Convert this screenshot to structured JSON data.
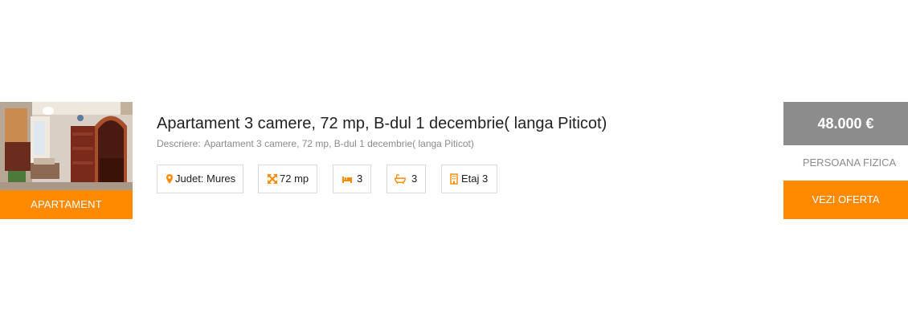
{
  "listing": {
    "type_label": "APARTAMENT",
    "title": "Apartament 3 camere, 72 mp, B-dul 1 decembrie( langa Piticot)",
    "description_label": "Descriere:",
    "description_text": "Apartament 3 camere, 72 mp, B-dul 1 decembrie( langa Piticot)",
    "features": {
      "county": {
        "icon": "map-marker-icon",
        "text": "Judet: Mures"
      },
      "area": {
        "icon": "expand-arrows-icon",
        "text": "72 mp"
      },
      "rooms": {
        "icon": "bed-icon",
        "text": "3"
      },
      "baths": {
        "icon": "bathtub-icon",
        "text": "3"
      },
      "floor": {
        "icon": "building-icon",
        "text": "Etaj 3"
      }
    },
    "price": "48.000 €",
    "seller_type": "PERSOANA FIZICA",
    "cta_label": "VEZI OFERTA"
  },
  "colors": {
    "accent": "#ff8a00",
    "price_background": "#8c8c8c",
    "muted_text": "#8c8c8c",
    "border": "#dcdcdc"
  }
}
